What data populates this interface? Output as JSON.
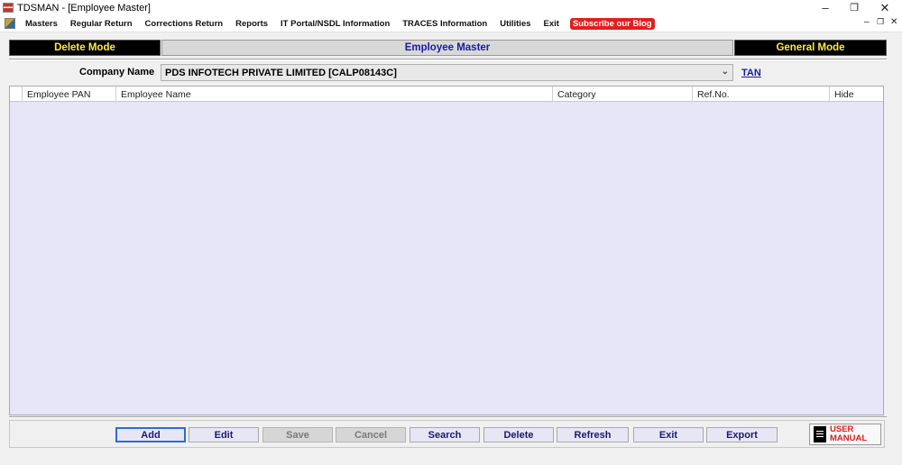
{
  "window": {
    "title": "TDSMAN - [Employee Master]",
    "controls": {
      "minimize": "–",
      "restore": "❐",
      "close": "✕"
    }
  },
  "menubar": {
    "items": [
      "Masters",
      "Regular Return",
      "Corrections Return",
      "Reports",
      "IT Portal/NSDL Information",
      "TRACES Information",
      "Utilities",
      "Exit"
    ],
    "blog_label": "Subscribe our Blog",
    "mdi_controls": {
      "minimize": "–",
      "restore": "❐",
      "close": "✕"
    }
  },
  "modes": {
    "left": "Delete Mode",
    "center": "Employee Master",
    "right": "General Mode"
  },
  "company": {
    "label": "Company Name",
    "value": "PDS INFOTECH PRIVATE LIMITED [CALP08143C]",
    "tan_link": "TAN"
  },
  "table": {
    "columns": [
      "Employee PAN",
      "Employee Name",
      "Category",
      "Ref.No.",
      "Hide"
    ],
    "rows": []
  },
  "buttons": {
    "add": "Add",
    "edit": "Edit",
    "save": "Save",
    "cancel": "Cancel",
    "search": "Search",
    "delete": "Delete",
    "refresh": "Refresh",
    "exit": "Exit",
    "export": "Export"
  },
  "user_manual": {
    "line1": "USER",
    "line2": "MANUAL"
  },
  "colors": {
    "accent_yellow": "#ffeb3b",
    "title_blue": "#1a1aa6",
    "grid_bg": "#e6e6f8",
    "blog_red": "#e02020"
  }
}
